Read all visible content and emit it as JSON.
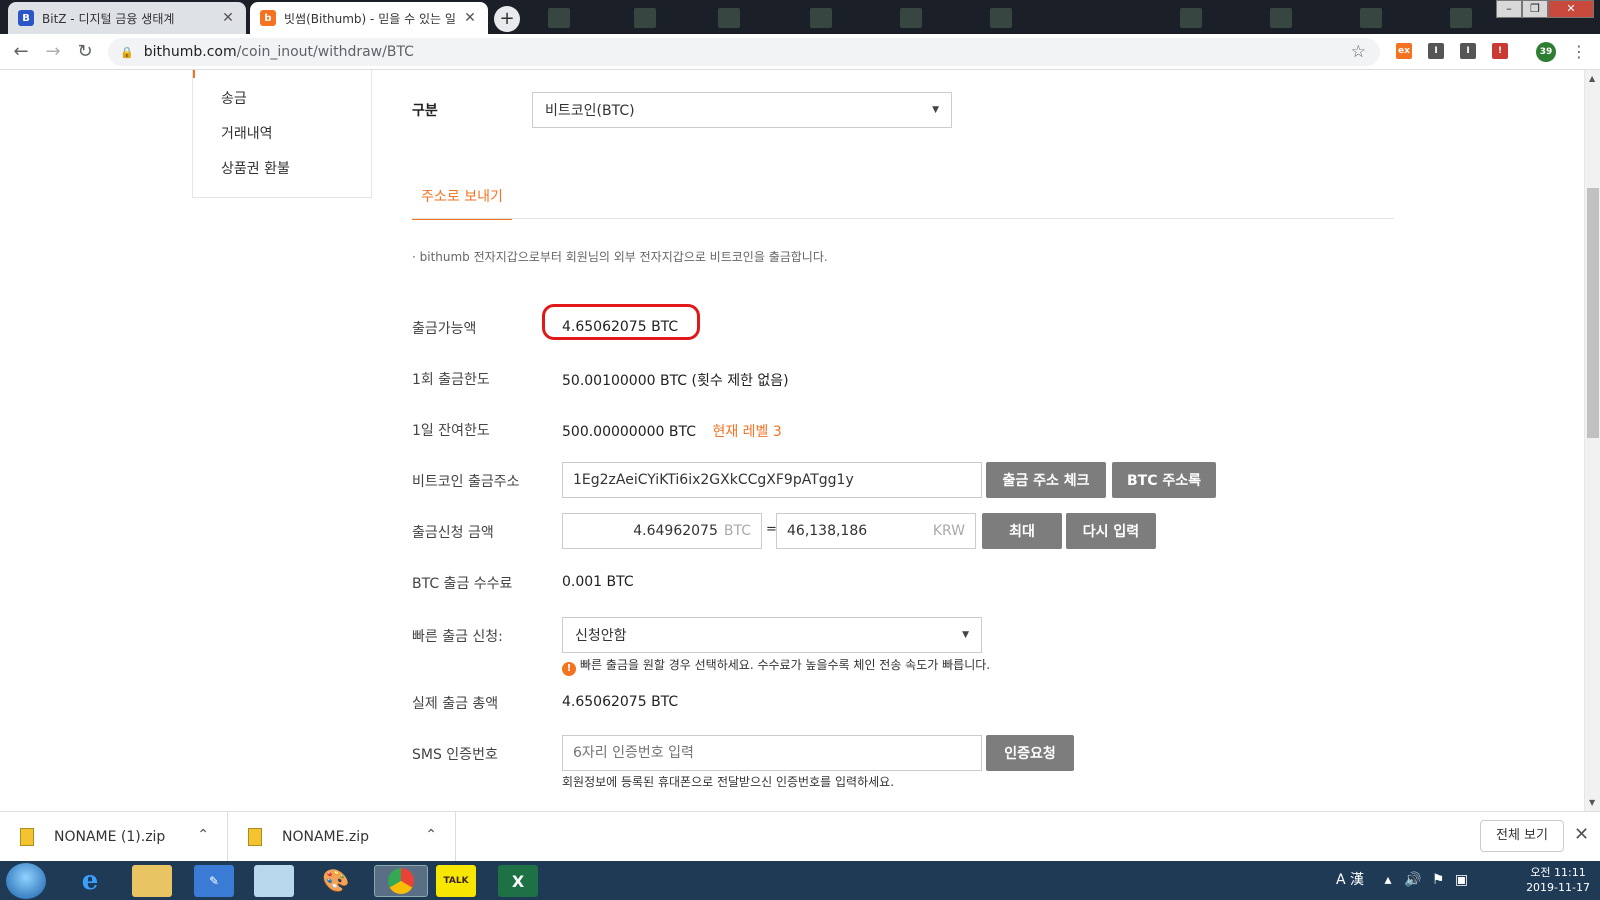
{
  "browser": {
    "tabs": [
      {
        "title": "BitZ - 디지털 금융 생태계",
        "favicon": "B"
      },
      {
        "title": "빗썸(Bithumb) - 믿을 수 있는 일",
        "favicon": "b"
      }
    ],
    "new_tab": "+",
    "url_host": "bithumb.com",
    "url_path": "/coin_inout/withdraw/BTC",
    "profile_badge": "39",
    "extensions": [
      "ex",
      "I",
      "I",
      "!"
    ]
  },
  "sidenav": {
    "items": [
      "송금",
      "거래내역",
      "상품권 환불"
    ]
  },
  "form": {
    "category_label": "구분",
    "category_value": "비트코인(BTC)",
    "tab_label": "주소로 보내기",
    "notice": "· bithumb 전자지갑으로부터 회원님의 외부 전자지갑으로 비트코인을 출금합니다.",
    "available_label": "출금가능액",
    "available_value": "4.65062075 BTC",
    "per_tx_label": "1회 출금한도",
    "per_tx_value": "50.00100000 BTC (횟수 제한 없음)",
    "daily_label": "1일 잔여한도",
    "daily_value": "500.00000000 BTC",
    "level_text": "현재 레벨 3",
    "address_label": "비트코인 출금주소",
    "address_value": "1Eg2zAeiCYiKTi6ix2GXkCCgXF9pATgg1y",
    "check_address_btn": "출금 주소 체크",
    "address_book_btn": "BTC 주소록",
    "amount_label": "출금신청 금액",
    "amount_btc": "4.64962075",
    "amount_btc_unit": "BTC",
    "equals": "=",
    "amount_krw": "46,138,186",
    "amount_krw_unit": "KRW",
    "max_btn": "최대",
    "reset_btn": "다시 입력",
    "fee_label": "BTC 출금 수수료",
    "fee_value": "0.001 BTC",
    "fast_label": "빠른 출금 신청:",
    "fast_value": "신청안함",
    "fast_hint": "빠른 출금을 원할 경우 선택하세요. 수수료가 높을수록 체인 전송 속도가 빠릅니다.",
    "total_label": "실제 출금 총액",
    "total_value": "4.65062075 BTC",
    "sms_label": "SMS 인증번호",
    "sms_placeholder": "6자리 인증번호 입력",
    "sms_btn": "인증요청",
    "sms_hint": "회원정보에 등록된 휴대폰으로 전달받으신 인증번호를 입력하세요."
  },
  "downloads": {
    "files": [
      "NONAME (1).zip",
      "NONAME.zip"
    ],
    "show_all": "전체 보기"
  },
  "taskbar": {
    "ime": "A 漢",
    "time": "오전 11:11",
    "date": "2019-11-17",
    "apps": [
      "IE",
      "Explorer",
      "Editor",
      "Tool",
      "Paint",
      "Chrome",
      "KakaoTalk",
      "Excel"
    ],
    "kakao_label": "TALK",
    "excel_label": "X"
  },
  "colors": {
    "accent": "#f37321",
    "highlight_circle": "#e11818",
    "button_gray": "#7d7d7d"
  }
}
